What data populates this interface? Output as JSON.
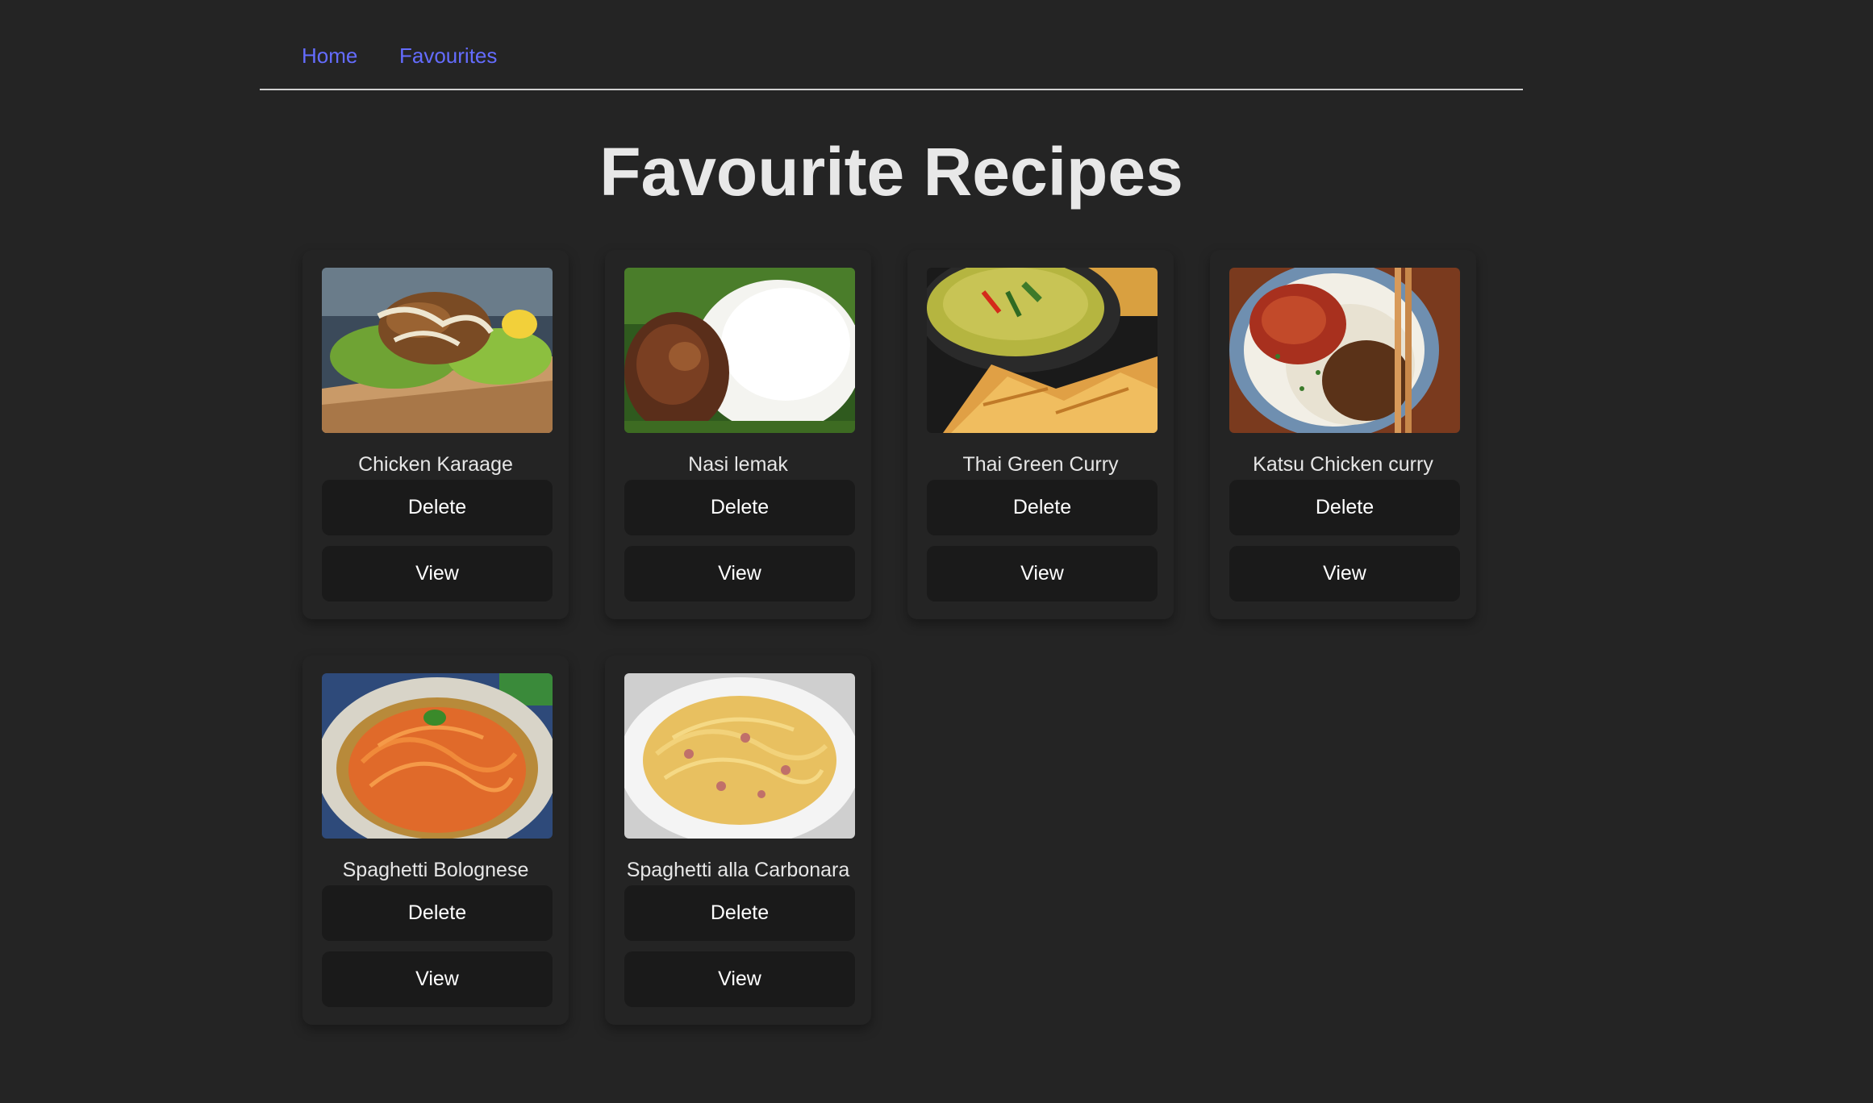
{
  "nav": {
    "home_label": "Home",
    "favourites_label": "Favourites",
    "link_color": "#646cff"
  },
  "page_title": "Favourite Recipes",
  "recipes": [
    {
      "name": "Chicken Karaage",
      "delete_label": "Delete",
      "view_label": "View",
      "image": "chicken-karaage-photo"
    },
    {
      "name": "Nasi lemak",
      "delete_label": "Delete",
      "view_label": "View",
      "image": "nasi-lemak-photo"
    },
    {
      "name": "Thai Green Curry",
      "delete_label": "Delete",
      "view_label": "View",
      "image": "thai-green-curry-photo"
    },
    {
      "name": "Katsu Chicken curry",
      "delete_label": "Delete",
      "view_label": "View",
      "image": "katsu-chicken-curry-photo"
    },
    {
      "name": "Spaghetti Bolognese",
      "delete_label": "Delete",
      "view_label": "View",
      "image": "spaghetti-bolognese-photo"
    },
    {
      "name": "Spaghetti alla Carbonara",
      "delete_label": "Delete",
      "view_label": "View",
      "image": "spaghetti-carbonara-photo"
    }
  ]
}
